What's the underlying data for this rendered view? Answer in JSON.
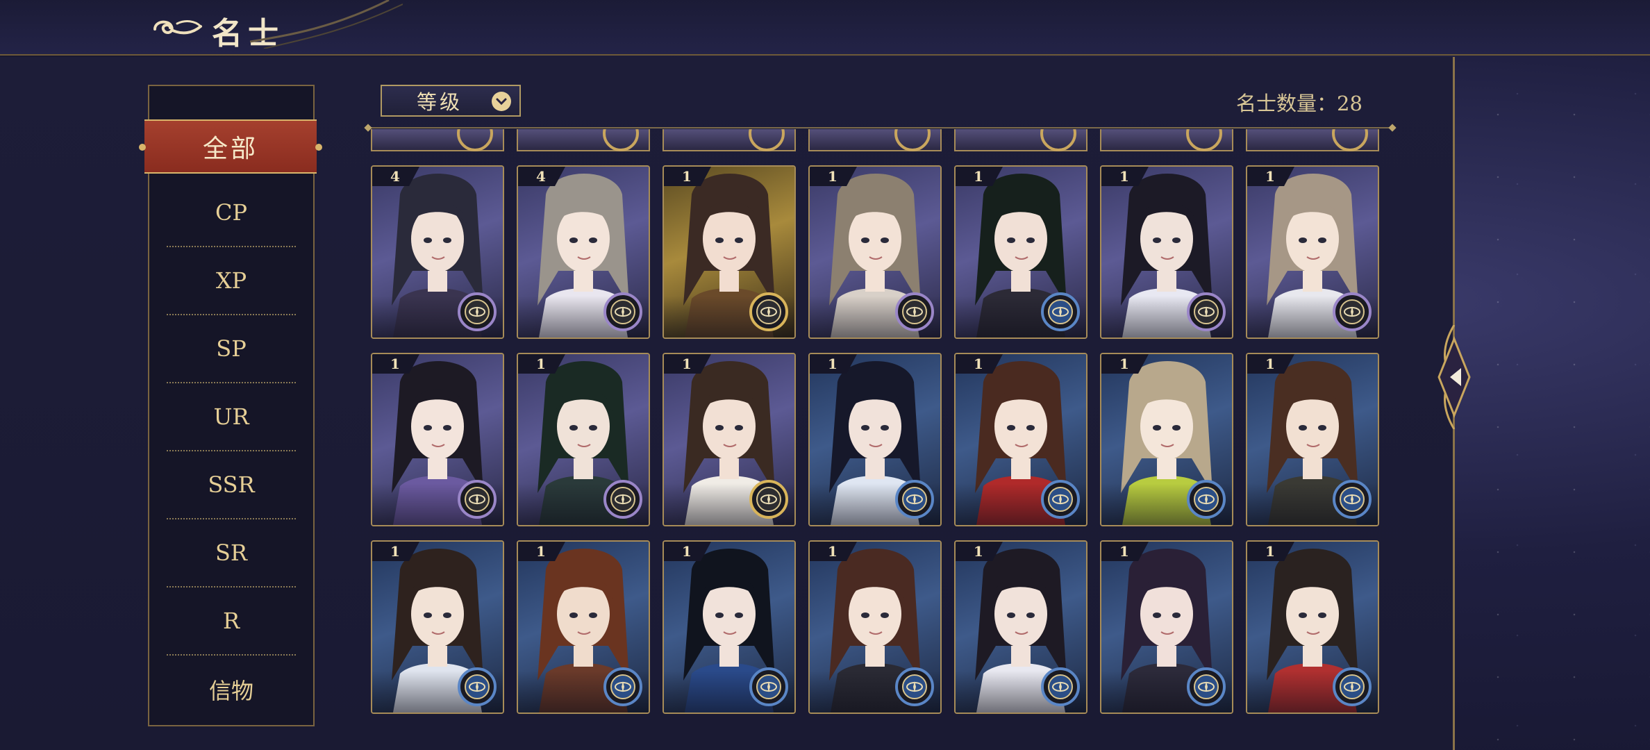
{
  "header": {
    "title": "名士"
  },
  "sidebar": {
    "items": [
      {
        "label": "全部",
        "active": true
      },
      {
        "label": "CP"
      },
      {
        "label": "XP"
      },
      {
        "label": "SP"
      },
      {
        "label": "UR"
      },
      {
        "label": "SSR"
      },
      {
        "label": "SR"
      },
      {
        "label": "R"
      },
      {
        "label": "信物"
      }
    ]
  },
  "toolbar": {
    "sort_label": "等级",
    "count_text": "名士数量：28"
  },
  "cards": [
    {
      "level": "4",
      "bg": "purple",
      "ring": "purple",
      "hair": "#2a2a3a",
      "skin": "#f1e1d8",
      "cloth": "#3a3450"
    },
    {
      "level": "4",
      "bg": "purple",
      "ring": "purple",
      "hair": "#9a948c",
      "skin": "#f3e4da",
      "cloth": "#e9e6ef"
    },
    {
      "level": "1",
      "bg": "gold",
      "ring": "gold",
      "hair": "#3b2a24",
      "skin": "#f2ddd0",
      "cloth": "#6a4a2a"
    },
    {
      "level": "1",
      "bg": "purple",
      "ring": "purple",
      "hair": "#8c8070",
      "skin": "#f3e2d6",
      "cloth": "#d8d0c8"
    },
    {
      "level": "1",
      "bg": "purple",
      "ring": "blue",
      "hair": "#16201c",
      "skin": "#f1e0d6",
      "cloth": "#2c2a36"
    },
    {
      "level": "1",
      "bg": "purple",
      "ring": "purple",
      "hair": "#1c1a26",
      "skin": "#f0e2da",
      "cloth": "#e8e8f2"
    },
    {
      "level": "1",
      "bg": "purple",
      "ring": "purple",
      "hair": "#a69786",
      "skin": "#f3e3d6",
      "cloth": "#e8e8ee"
    },
    {
      "level": "1",
      "bg": "purple",
      "ring": "purple",
      "hair": "#1d1a24",
      "skin": "#f3e4dc",
      "cloth": "#6b5aa0"
    },
    {
      "level": "1",
      "bg": "purple",
      "ring": "purple",
      "hair": "#1a2a24",
      "skin": "#f0e2d8",
      "cloth": "#2a3a3a"
    },
    {
      "level": "1",
      "bg": "purple",
      "ring": "gold",
      "hair": "#3a2a22",
      "skin": "#f2e0d4",
      "cloth": "#f0ece6"
    },
    {
      "level": "1",
      "bg": "blue",
      "ring": "blue",
      "hair": "#16182a",
      "skin": "#f1e2da",
      "cloth": "#dfe6f2"
    },
    {
      "level": "1",
      "bg": "blue",
      "ring": "blue",
      "hair": "#4a2a20",
      "skin": "#f3e2d6",
      "cloth": "#b02a2a"
    },
    {
      "level": "1",
      "bg": "blue",
      "ring": "blue",
      "hair": "#b8a88c",
      "skin": "#f4e6da",
      "cloth": "#b8cc40"
    },
    {
      "level": "1",
      "bg": "blue",
      "ring": "blue",
      "hair": "#4a2e22",
      "skin": "#f2e0d2",
      "cloth": "#3a3a34"
    },
    {
      "level": "1",
      "bg": "blue",
      "ring": "blue",
      "hair": "#2e221e",
      "skin": "#f2e2d6",
      "cloth": "#dfe4ee"
    },
    {
      "level": "1",
      "bg": "blue",
      "ring": "blue",
      "hair": "#6a3420",
      "skin": "#f0dccc",
      "cloth": "#6a3a2a"
    },
    {
      "level": "1",
      "bg": "blue",
      "ring": "blue",
      "hair": "#10141e",
      "skin": "#f1e2da",
      "cloth": "#2a4a8a"
    },
    {
      "level": "1",
      "bg": "blue",
      "ring": "blue",
      "hair": "#4a2a22",
      "skin": "#f3e2d6",
      "cloth": "#2a2a34"
    },
    {
      "level": "1",
      "bg": "blue",
      "ring": "blue",
      "hair": "#1e1a24",
      "skin": "#f1e2da",
      "cloth": "#e8e8f0"
    },
    {
      "level": "1",
      "bg": "blue",
      "ring": "blue",
      "hair": "#2a2036",
      "skin": "#f1e0da",
      "cloth": "#2c2a3a"
    },
    {
      "level": "1",
      "bg": "blue",
      "ring": "blue",
      "hair": "#2a2220",
      "skin": "#f2e2d6",
      "cloth": "#b03030"
    }
  ],
  "colors": {
    "accent_gold": "#d9b56b",
    "active_red": "#a5402e",
    "panel_bg": "#1d1d38"
  },
  "icons": {
    "header": "cloud-swirl-icon",
    "sort": "chevron-down-icon",
    "card_ring": "compass-icon",
    "panel_edge": "collapse-arrow-icon"
  }
}
